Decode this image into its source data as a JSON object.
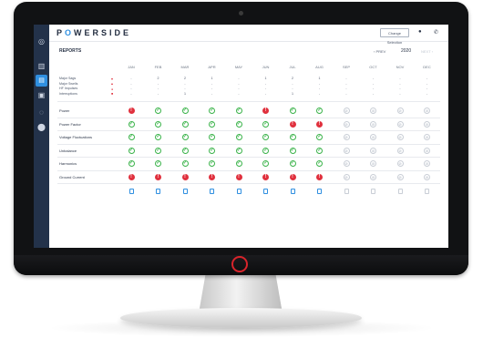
{
  "app": {
    "logo_prefix": "P",
    "logo_o": "O",
    "logo_suffix": "WERSIDE"
  },
  "header": {
    "change_button": "Change Selection"
  },
  "reports": {
    "title": "REPORTS",
    "prev_label": "‹ PREV",
    "year": "2020",
    "next_label": "NEXT ›"
  },
  "months": [
    "JAN",
    "FEB",
    "MAR",
    "APR",
    "MAY",
    "JUN",
    "JUL",
    "AUG",
    "SEP",
    "OCT",
    "NOV",
    "DEC"
  ],
  "legend": [
    {
      "label": "Major Sags",
      "icon": "triangle-down-icon"
    },
    {
      "label": "Major Swells",
      "icon": "triangle-up-icon"
    },
    {
      "label": "HF Impulses",
      "icon": "circle-icon"
    },
    {
      "label": "Interruptions",
      "icon": "square-icon"
    }
  ],
  "counts": [
    [
      "-",
      "2",
      "2",
      "1",
      "-",
      "1",
      "2",
      "1",
      "-",
      "-",
      "-",
      "-"
    ],
    [
      "-",
      "-",
      "-",
      "-",
      "-",
      "-",
      "-",
      "-",
      "-",
      "-",
      "-",
      "-"
    ],
    [
      "-",
      "-",
      "-",
      "-",
      "-",
      "-",
      "-",
      "-",
      "-",
      "-",
      "-",
      "-"
    ],
    [
      "-",
      "-",
      "1",
      "-",
      "-",
      "-",
      "1",
      "-",
      "-",
      "-",
      "-",
      "-"
    ]
  ],
  "rows": [
    {
      "label": "Power",
      "status": [
        "bad",
        "ok",
        "ok",
        "ok",
        "ok",
        "bad",
        "ok",
        "ok",
        "na",
        "na",
        "na",
        "na"
      ]
    },
    {
      "label": "Power Factor",
      "status": [
        "ok",
        "ok",
        "ok",
        "ok",
        "ok",
        "ok",
        "bad",
        "bad",
        "na",
        "na",
        "na",
        "na"
      ]
    },
    {
      "label": "Voltage Fluctuations",
      "status": [
        "ok",
        "ok",
        "ok",
        "ok",
        "ok",
        "ok",
        "ok",
        "ok",
        "na",
        "na",
        "na",
        "na"
      ]
    },
    {
      "label": "Unbalance",
      "status": [
        "ok",
        "ok",
        "ok",
        "ok",
        "ok",
        "ok",
        "ok",
        "ok",
        "na",
        "na",
        "na",
        "na"
      ]
    },
    {
      "label": "Harmonics",
      "status": [
        "ok",
        "ok",
        "ok",
        "ok",
        "ok",
        "ok",
        "ok",
        "ok",
        "na",
        "na",
        "na",
        "na"
      ]
    },
    {
      "label": "Ground Current",
      "status": [
        "bad",
        "bad",
        "bad",
        "bad",
        "bad",
        "bad",
        "bad",
        "bad",
        "na",
        "na",
        "na",
        "na"
      ]
    }
  ],
  "reports_available": [
    true,
    true,
    true,
    true,
    true,
    true,
    true,
    true,
    false,
    false,
    false,
    false
  ],
  "colors": {
    "ok": "#3bb34a",
    "bad": "#e0303d",
    "na": "#c9ced6",
    "accent": "#2f8fe0",
    "sidebar": "#23324a"
  }
}
